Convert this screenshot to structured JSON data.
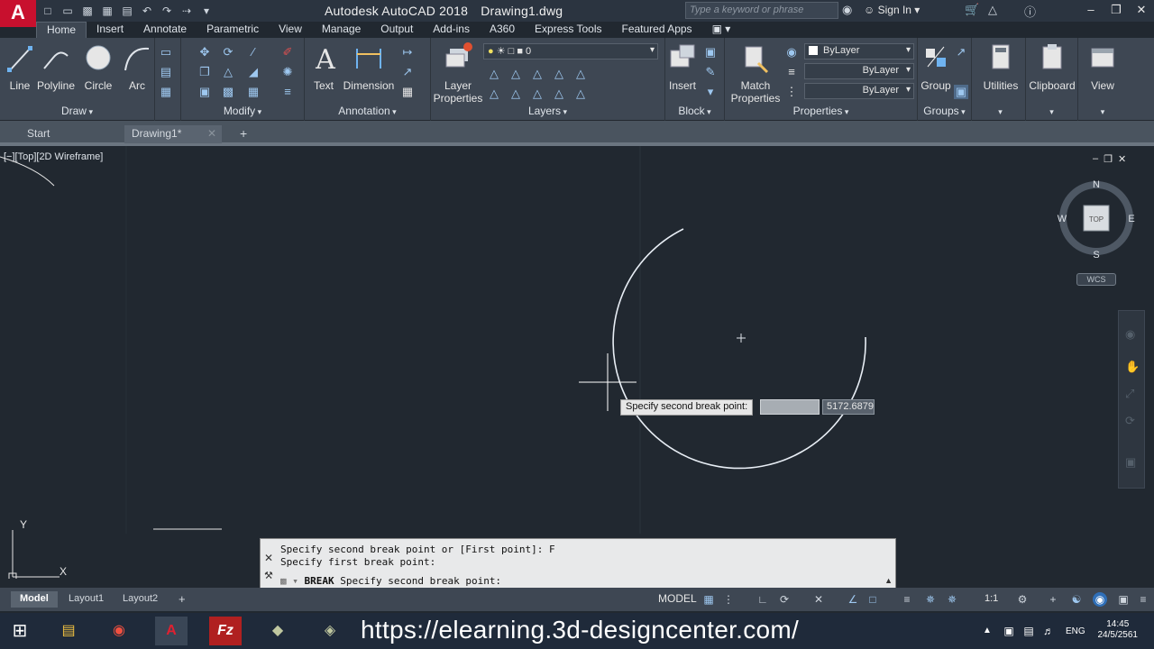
{
  "window": {
    "app_title": "Autodesk AutoCAD 2018",
    "doc_title": "Drawing1.dwg",
    "search_placeholder": "Type a keyword or phrase",
    "sign_in": "Sign In",
    "logo": "A"
  },
  "ribbon_tabs": [
    "Home",
    "Insert",
    "Annotate",
    "Parametric",
    "View",
    "Manage",
    "Output",
    "Add-ins",
    "A360",
    "Express Tools",
    "Featured Apps"
  ],
  "ribbon": {
    "draw": {
      "title": "Draw",
      "buttons": [
        "Line",
        "Polyline",
        "Circle",
        "Arc"
      ]
    },
    "modify": {
      "title": "Modify"
    },
    "annotation": {
      "title": "Annotation",
      "buttons": [
        "Text",
        "Dimension"
      ]
    },
    "layers": {
      "title": "Layers",
      "layer_properties": "Layer",
      "layer_properties2": "Properties",
      "current_layer": "0"
    },
    "block": {
      "title": "Block",
      "insert": "Insert"
    },
    "properties": {
      "title": "Properties",
      "match": "Match",
      "match2": "Properties",
      "color": "ByLayer",
      "linetype": "ByLayer",
      "lineweight": "ByLayer"
    },
    "groups": {
      "title": "Groups",
      "group": "Group"
    },
    "utilities": "Utilities",
    "clipboard": "Clipboard",
    "view": "View"
  },
  "file_tabs": {
    "start": "Start",
    "active": "Drawing1*"
  },
  "viewport": {
    "label": "[−][Top][2D Wireframe]",
    "viewcube": {
      "n": "N",
      "s": "S",
      "e": "E",
      "w": "W",
      "face": "TOP"
    },
    "wcs": "WCS"
  },
  "dynamic_input": {
    "prompt": "Specify second break point:",
    "value": "5172.6879"
  },
  "command_line": {
    "history": [
      "Specify second break point or [First point]: F",
      "Specify first break point:"
    ],
    "command": "BREAK",
    "prompt": "Specify second break point:"
  },
  "layout_tabs": [
    "Model",
    "Layout1",
    "Layout2"
  ],
  "status": {
    "model": "MODEL",
    "scale": "1:1"
  },
  "taskbar": {
    "url": "https://elearning.3d-designcenter.com/",
    "lang": "ENG",
    "time": "14:45",
    "date": "24/5/2561"
  },
  "colors": {
    "canvas": "#212830",
    "ribbon": "#3e4753",
    "accent": "#c8102e"
  }
}
